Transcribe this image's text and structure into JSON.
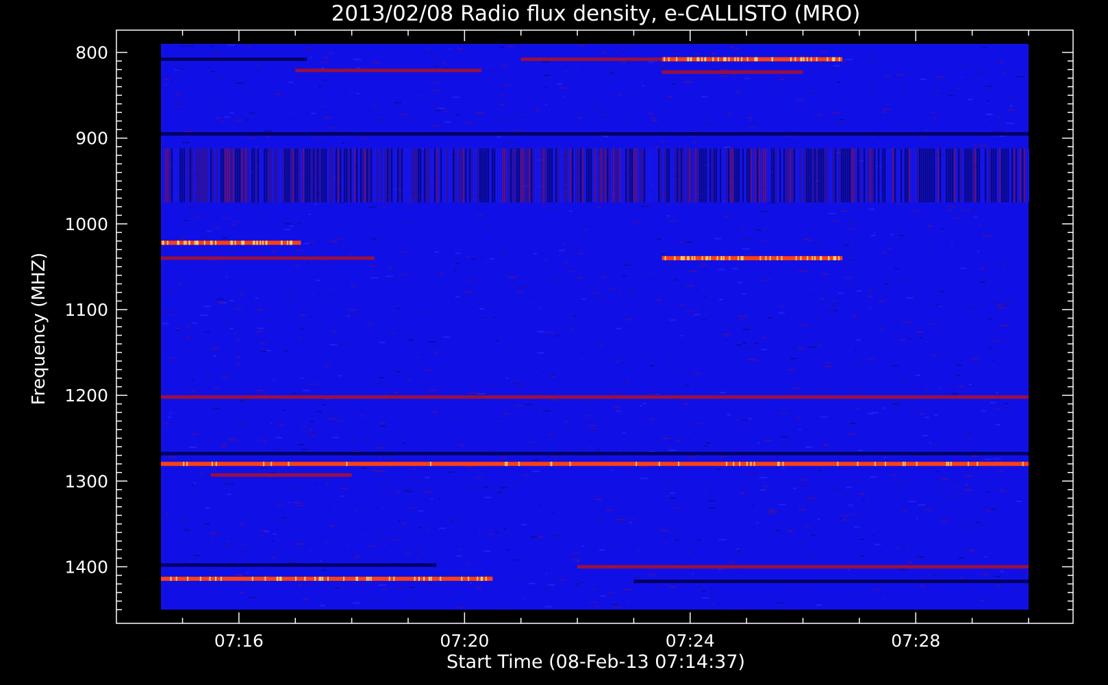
{
  "chart_data": {
    "type": "heatmap",
    "title": "2013/02/08  Radio flux density, e-CALLISTO (MRO)",
    "xlabel": "Start Time (08-Feb-13 07:14:37)",
    "ylabel": "Frequency (MHZ)",
    "x_ticks": [
      "07:16",
      "07:20",
      "07:24",
      "07:28"
    ],
    "x_tick_minutes": [
      16,
      20,
      24,
      28
    ],
    "x_range_minutes": [
      14.617,
      30.0
    ],
    "y_ticks": [
      800,
      900,
      1000,
      1100,
      1200,
      1300,
      1400
    ],
    "y_range": [
      790,
      1450
    ],
    "y_inverted": true,
    "colors": {
      "background": "#1010e6",
      "low": "#000060",
      "mid": "#b01020",
      "high": "#ff4010",
      "peak": "#ffe070"
    },
    "bands": [
      {
        "freq": 808,
        "t_start": 23.5,
        "t_end": 26.7,
        "level": "high"
      },
      {
        "freq": 808,
        "t_start": 21.0,
        "t_end": 23.5,
        "level": "mid"
      },
      {
        "freq": 808,
        "t_start": 14.617,
        "t_end": 17.2,
        "level": "low"
      },
      {
        "freq": 821,
        "t_start": 17.0,
        "t_end": 20.3,
        "level": "mid"
      },
      {
        "freq": 823,
        "t_start": 23.5,
        "t_end": 26.0,
        "level": "mid"
      },
      {
        "freq": 895,
        "t_start": 14.617,
        "t_end": 30.0,
        "level": "low"
      },
      {
        "freq": 1022,
        "t_start": 14.617,
        "t_end": 17.1,
        "level": "high"
      },
      {
        "freq": 1040,
        "t_start": 14.617,
        "t_end": 18.4,
        "level": "mid"
      },
      {
        "freq": 1040,
        "t_start": 23.5,
        "t_end": 26.7,
        "level": "high"
      },
      {
        "freq": 1202,
        "t_start": 14.617,
        "t_end": 30.0,
        "level": "mid"
      },
      {
        "freq": 1268,
        "t_start": 14.617,
        "t_end": 30.0,
        "level": "low"
      },
      {
        "freq": 1280,
        "t_start": 14.617,
        "t_end": 30.0,
        "level": "high"
      },
      {
        "freq": 1293,
        "t_start": 15.5,
        "t_end": 18.0,
        "level": "mid"
      },
      {
        "freq": 1398,
        "t_start": 14.617,
        "t_end": 19.5,
        "level": "low"
      },
      {
        "freq": 1400,
        "t_start": 22.0,
        "t_end": 30.0,
        "level": "mid"
      },
      {
        "freq": 1414,
        "t_start": 14.617,
        "t_end": 20.5,
        "level": "high"
      },
      {
        "freq": 1417,
        "t_start": 23.0,
        "t_end": 30.0,
        "level": "low"
      }
    ]
  }
}
